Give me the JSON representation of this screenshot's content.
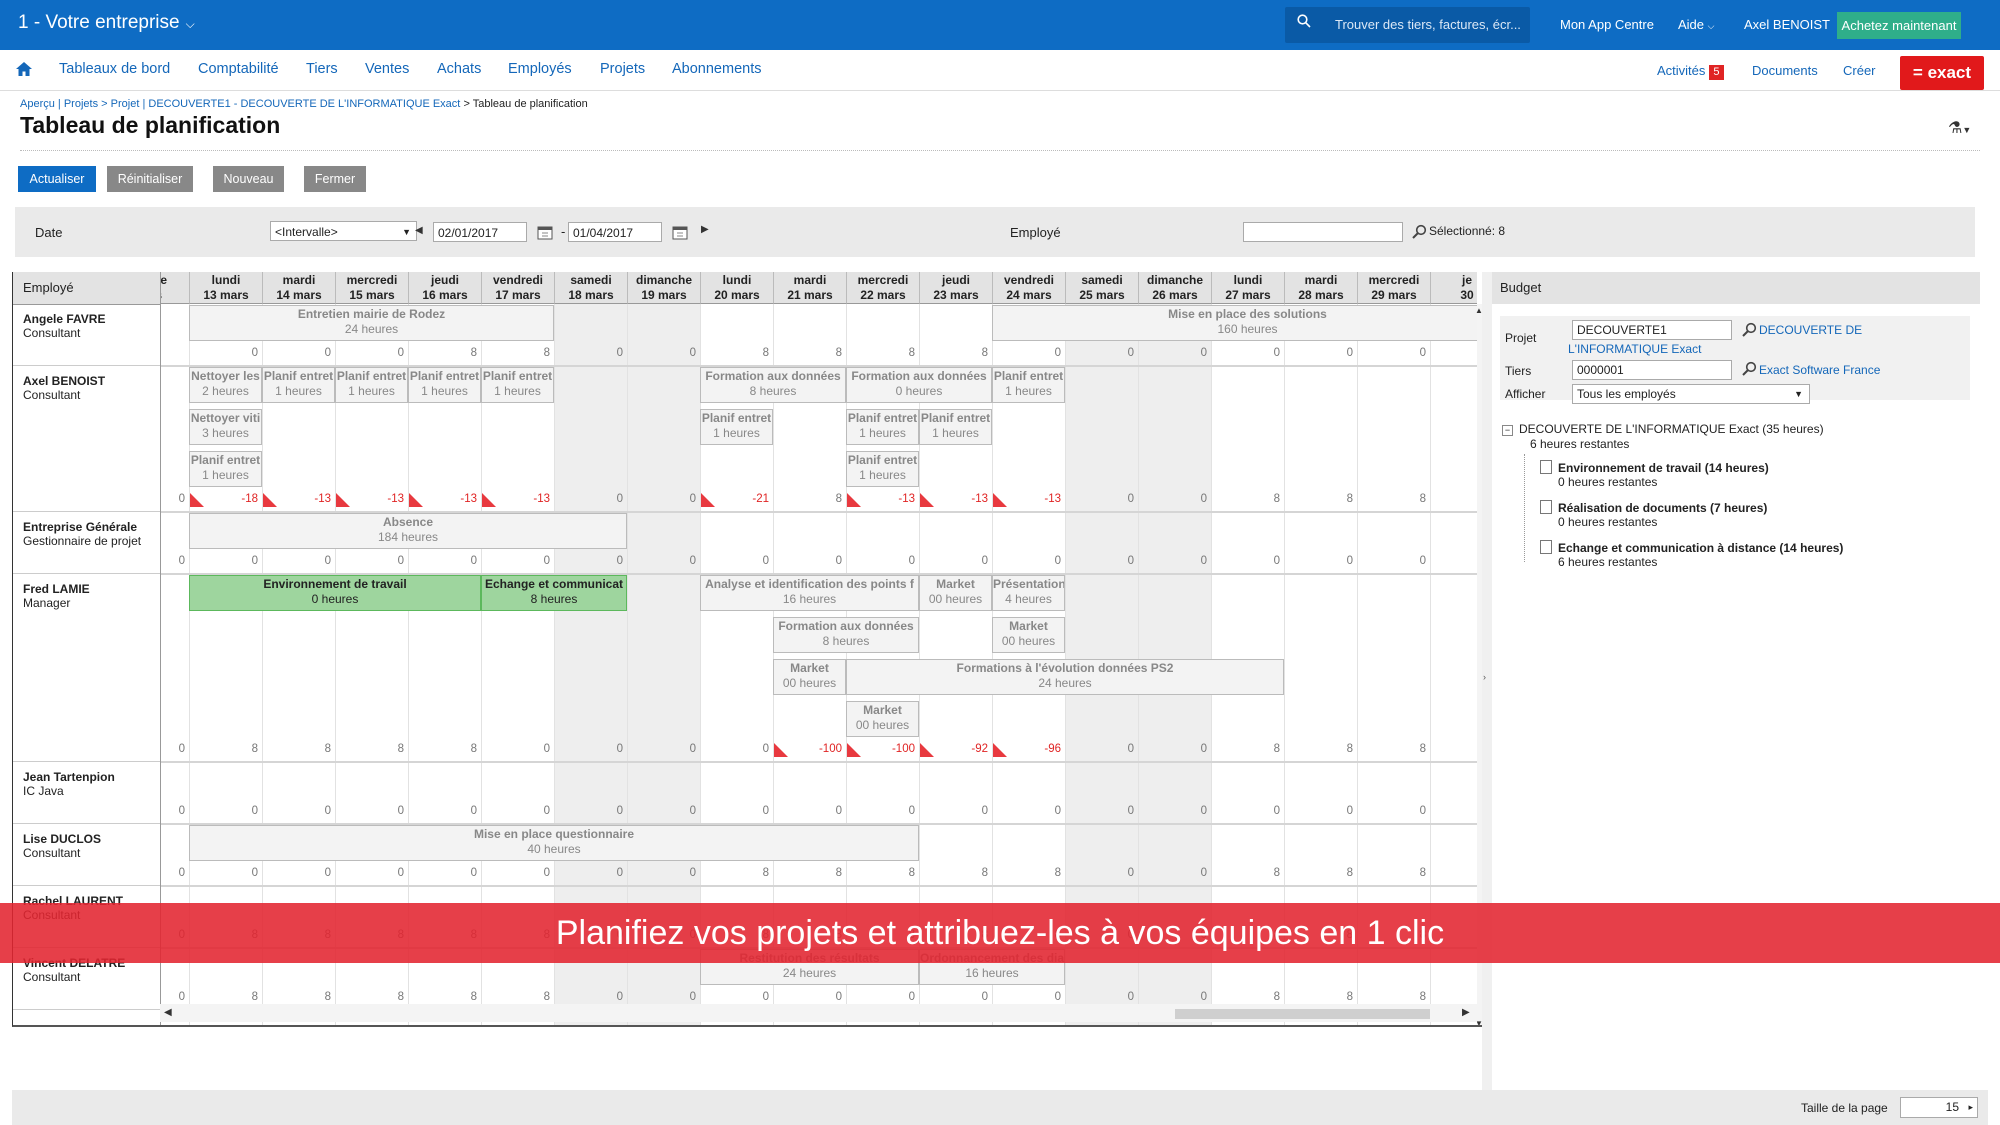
{
  "topbar": {
    "company": "1 - Votre entreprise",
    "search_placeholder": "Trouver des tiers, factures, écr...",
    "app_centre": "Mon App Centre",
    "help": "Aide",
    "user": "Axel BENOIST",
    "buy_now": "Achetez maintenant"
  },
  "nav": {
    "items": [
      "Tableaux de bord",
      "Comptabilité",
      "Tiers",
      "Ventes",
      "Achats",
      "Employés",
      "Projets",
      "Abonnements"
    ],
    "activities": "Activités",
    "activities_count": "5",
    "documents": "Documents",
    "create": "Créer",
    "logo": "= exact"
  },
  "breadcrumb": {
    "apercu": "Aperçu",
    "projets": "Projets",
    "projet": "Projet",
    "projet_name": "DECOUVERTE1 - DECOUVERTE DE L'INFORMATIQUE Exact",
    "current": "Tableau de planification"
  },
  "page_title": "Tableau de planification",
  "buttons": {
    "refresh": "Actualiser",
    "reset": "Réinitialiser",
    "new": "Nouveau",
    "close": "Fermer"
  },
  "filter": {
    "date_label": "Date",
    "interval": "<Intervalle>",
    "date_from": "02/01/2017",
    "date_to": "01/04/2017",
    "employee_label": "Employé",
    "employee_value": "",
    "selected": "Sélectionné: 8"
  },
  "grid": {
    "employee_header": "Employé",
    "days": [
      {
        "d": "nche",
        "m": "ars",
        "w": false
      },
      {
        "d": "lundi",
        "m": "13 mars",
        "w": false
      },
      {
        "d": "mardi",
        "m": "14 mars",
        "w": false
      },
      {
        "d": "mercredi",
        "m": "15 mars",
        "w": false
      },
      {
        "d": "jeudi",
        "m": "16 mars",
        "w": false
      },
      {
        "d": "vendredi",
        "m": "17 mars",
        "w": false
      },
      {
        "d": "samedi",
        "m": "18 mars",
        "w": true
      },
      {
        "d": "dimanche",
        "m": "19 mars",
        "w": true
      },
      {
        "d": "lundi",
        "m": "20 mars",
        "w": false
      },
      {
        "d": "mardi",
        "m": "21 mars",
        "w": false
      },
      {
        "d": "mercredi",
        "m": "22 mars",
        "w": false
      },
      {
        "d": "jeudi",
        "m": "23 mars",
        "w": false
      },
      {
        "d": "vendredi",
        "m": "24 mars",
        "w": false
      },
      {
        "d": "samedi",
        "m": "25 mars",
        "w": true
      },
      {
        "d": "dimanche",
        "m": "26 mars",
        "w": true
      },
      {
        "d": "lundi",
        "m": "27 mars",
        "w": false
      },
      {
        "d": "mardi",
        "m": "28 mars",
        "w": false
      },
      {
        "d": "mercredi",
        "m": "29 mars",
        "w": false
      },
      {
        "d": "je",
        "m": "30",
        "w": false
      }
    ],
    "employees": [
      {
        "name": "Angele FAVRE",
        "role": "Consultant",
        "h": 62,
        "totals": [
          "",
          "0",
          "0",
          "0",
          "8",
          "8",
          "0",
          "0",
          "8",
          "8",
          "8",
          "8",
          "0",
          "0",
          "0",
          "0",
          "0",
          "0",
          "0"
        ],
        "blocks": [
          {
            "c": 1,
            "s": 5,
            "r": 0,
            "t": "Entretien mairie de Rodez",
            "h": "24 heures"
          },
          {
            "c": 12,
            "s": 7,
            "r": 0,
            "t": "Mise en place des solutions",
            "h": "160 heures"
          }
        ]
      },
      {
        "name": "Axel BENOIST",
        "role": "Consultant",
        "h": 146,
        "totals": [
          "0",
          "-18",
          "-13",
          "-13",
          "-13",
          "-13",
          "0",
          "0",
          "-21",
          "8",
          "-13",
          "-13",
          "-13",
          "0",
          "0",
          "8",
          "8",
          "8",
          "8"
        ],
        "blocks": [
          {
            "c": 1,
            "s": 1,
            "r": 0,
            "t": "Nettoyer les",
            "h": "2 heures"
          },
          {
            "c": 2,
            "s": 1,
            "r": 0,
            "t": "Planif entret",
            "h": "1 heures"
          },
          {
            "c": 3,
            "s": 1,
            "r": 0,
            "t": "Planif entret",
            "h": "1 heures"
          },
          {
            "c": 4,
            "s": 1,
            "r": 0,
            "t": "Planif entret",
            "h": "1 heures"
          },
          {
            "c": 5,
            "s": 1,
            "r": 0,
            "t": "Planif entret",
            "h": "1 heures"
          },
          {
            "c": 1,
            "s": 1,
            "r": 1,
            "t": "Nettoyer viti",
            "h": "3 heures"
          },
          {
            "c": 1,
            "s": 1,
            "r": 2,
            "t": "Planif entret",
            "h": "1 heures"
          },
          {
            "c": 8,
            "s": 2,
            "r": 0,
            "t": "Formation aux données",
            "h": "8 heures"
          },
          {
            "c": 10,
            "s": 2,
            "r": 0,
            "t": "Formation aux données",
            "h": "0 heures"
          },
          {
            "c": 12,
            "s": 1,
            "r": 0,
            "t": "Planif entret",
            "h": "1 heures"
          },
          {
            "c": 8,
            "s": 1,
            "r": 1,
            "t": "Planif entret",
            "h": "1 heures"
          },
          {
            "c": 10,
            "s": 1,
            "r": 1,
            "t": "Planif entret",
            "h": "1 heures"
          },
          {
            "c": 11,
            "s": 1,
            "r": 1,
            "t": "Planif entret",
            "h": "1 heures"
          },
          {
            "c": 10,
            "s": 1,
            "r": 2,
            "t": "Planif entret",
            "h": "1 heures"
          }
        ]
      },
      {
        "name": "Entreprise Générale",
        "role": "Gestionnaire de projet",
        "h": 62,
        "totals": [
          "0",
          "0",
          "0",
          "0",
          "0",
          "0",
          "0",
          "0",
          "0",
          "0",
          "0",
          "0",
          "0",
          "0",
          "0",
          "0",
          "0",
          "0",
          "0"
        ],
        "blocks": [
          {
            "c": 1,
            "s": 6,
            "r": 0,
            "t": "Absence",
            "h": "184 heures"
          }
        ]
      },
      {
        "name": "Fred LAMIE",
        "role": "Manager",
        "h": 188,
        "totals": [
          "0",
          "8",
          "8",
          "8",
          "8",
          "0",
          "0",
          "0",
          "0",
          "-100",
          "-100",
          "-92",
          "-96",
          "0",
          "0",
          "8",
          "8",
          "8",
          "8"
        ],
        "blocks": [
          {
            "c": 1,
            "s": 4,
            "r": 0,
            "t": "Environnement de travail",
            "h": "0 heures",
            "g": true
          },
          {
            "c": 5,
            "s": 2,
            "r": 0,
            "t": "Echange et communicat",
            "h": "8 heures",
            "g": true
          },
          {
            "c": 8,
            "s": 3,
            "r": 0,
            "t": "Analyse et identification des points f",
            "h": "16 heures"
          },
          {
            "c": 11,
            "s": 1,
            "r": 0,
            "t": "Market",
            "h": "00 heures"
          },
          {
            "c": 12,
            "s": 1,
            "r": 0,
            "t": "Présentation",
            "h": "4 heures"
          },
          {
            "c": 9,
            "s": 2,
            "r": 1,
            "t": "Formation aux données",
            "h": "8 heures"
          },
          {
            "c": 12,
            "s": 1,
            "r": 1,
            "t": "Market",
            "h": "00 heures"
          },
          {
            "c": 9,
            "s": 1,
            "r": 2,
            "t": "Market",
            "h": "00 heures"
          },
          {
            "c": 10,
            "s": 6,
            "r": 2,
            "t": "Formations à l'évolution données PS2",
            "h": "24 heures"
          },
          {
            "c": 10,
            "s": 1,
            "r": 3,
            "t": "Market",
            "h": "00 heures"
          }
        ]
      },
      {
        "name": "Jean Tartenpion",
        "role": "IC Java",
        "h": 62,
        "totals": [
          "0",
          "0",
          "0",
          "0",
          "0",
          "0",
          "0",
          "0",
          "0",
          "0",
          "0",
          "0",
          "0",
          "0",
          "0",
          "0",
          "0",
          "0",
          "0"
        ],
        "blocks": []
      },
      {
        "name": "Lise DUCLOS",
        "role": "Consultant",
        "h": 62,
        "totals": [
          "0",
          "0",
          "0",
          "0",
          "0",
          "0",
          "0",
          "0",
          "8",
          "8",
          "8",
          "8",
          "8",
          "0",
          "0",
          "8",
          "8",
          "8",
          "8"
        ],
        "blocks": [
          {
            "c": 1,
            "s": 10,
            "r": 0,
            "t": "Mise en place questionnaire",
            "h": "40 heures"
          }
        ]
      },
      {
        "name": "Rachel LAURENT",
        "role": "Consultant",
        "h": 62,
        "totals": [
          "0",
          "8",
          "8",
          "8",
          "8",
          "8",
          "0",
          "0",
          "8",
          "8",
          "8",
          "8",
          "8",
          "0",
          "0",
          "8",
          "8",
          "8",
          "8"
        ],
        "blocks": []
      },
      {
        "name": "Vincent DELATRE",
        "role": "Consultant",
        "h": 62,
        "totals": [
          "0",
          "8",
          "8",
          "8",
          "8",
          "8",
          "0",
          "0",
          "0",
          "0",
          "0",
          "0",
          "0",
          "0",
          "0",
          "8",
          "8",
          "8",
          "8"
        ],
        "blocks": [
          {
            "c": 8,
            "s": 3,
            "r": 0,
            "t": "Restitution des résultats",
            "h": "24 heures"
          },
          {
            "c": 11,
            "s": 2,
            "r": 0,
            "t": "Ordonnancement des diagr",
            "h": "16 heures"
          }
        ]
      }
    ]
  },
  "budget": {
    "title": "Budget",
    "project_label": "Projet",
    "project_code": "DECOUVERTE1",
    "project_link_1": "DECOUVERTE DE",
    "project_link_2": "L'INFORMATIQUE Exact",
    "tiers_label": "Tiers",
    "tiers_code": "0000001",
    "tiers_link": "Exact Software France",
    "show_label": "Afficher",
    "show_value": "Tous les employés",
    "root": "DECOUVERTE DE L'INFORMATIQUE Exact (35 heures)",
    "root_sub": "6 heures restantes",
    "items": [
      {
        "t": "Environnement de travail (14 heures)",
        "s": "0 heures restantes"
      },
      {
        "t": "Réalisation de documents (7 heures)",
        "s": "0 heures restantes"
      },
      {
        "t": "Echange et communication à distance (14 heures)",
        "s": "6 heures restantes"
      }
    ]
  },
  "footer": {
    "page_size_label": "Taille de la page",
    "page_size": "15"
  },
  "banner": "Planifiez vos projets et attribuez-les à vos équipes en 1 clic",
  "colors": {
    "brand": "#0e6cc4",
    "accent": "#2fae8a",
    "exact_red": "#e1191b",
    "banner": "#e22430",
    "block_green": "#9ed59e"
  }
}
